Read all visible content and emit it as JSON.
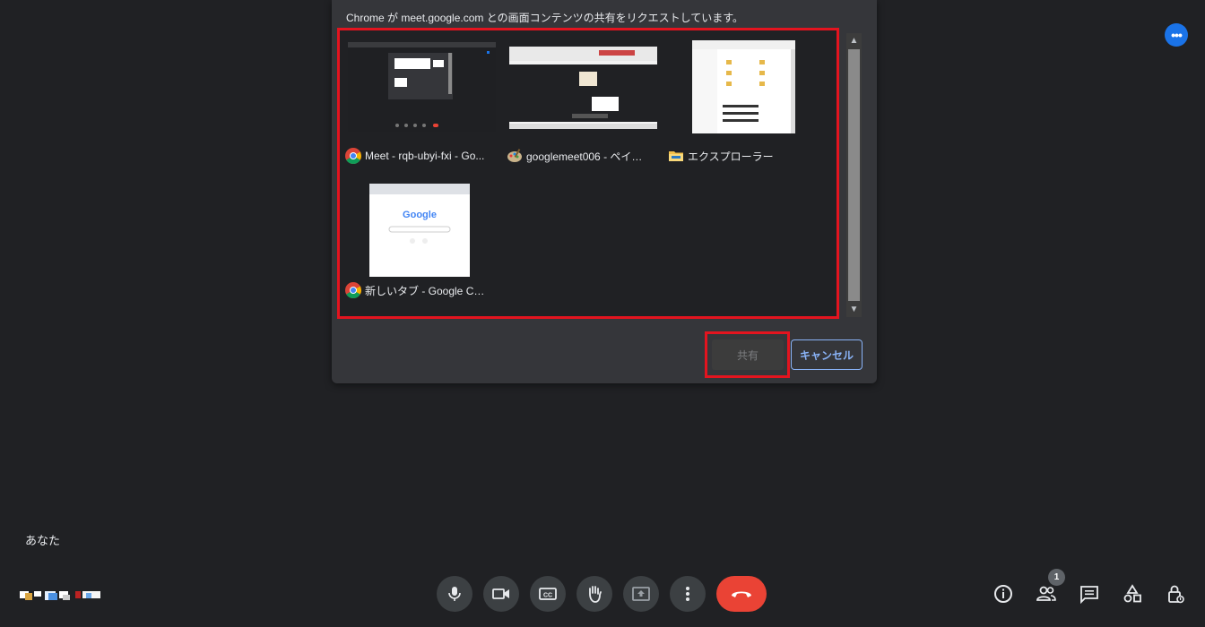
{
  "dialog": {
    "title": "Chrome が meet.google.com との画面コンテンツの共有をリクエストしています。",
    "sources": [
      {
        "label": "Meet - rqb-ubyi-fxi - Go...",
        "app_icon": "chrome-icon"
      },
      {
        "label": "googlemeet006 - ペイント",
        "app_icon": "paint-icon"
      },
      {
        "label": "エクスプローラー",
        "app_icon": "explorer-folder-icon"
      },
      {
        "label": "新しいタブ - Google Chro...",
        "app_icon": "chrome-icon",
        "thumb_text": "Google"
      }
    ],
    "share_label": "共有",
    "cancel_label": "キャンセル"
  },
  "participant": {
    "name": "あなた"
  },
  "toolbar": {
    "controls": [
      "mic-icon",
      "camera-icon",
      "captions-icon",
      "raise-hand-icon",
      "present-screen-icon",
      "more-options-icon",
      "hangup-icon"
    ],
    "right": [
      "info-icon",
      "people-icon",
      "chat-icon",
      "activities-icon",
      "host-controls-icon"
    ],
    "people_count": "1"
  },
  "colors": {
    "highlight": "#e3141f",
    "accent": "#8ab4f8",
    "hangup": "#ea4335",
    "more_button": "#1a73e8"
  }
}
